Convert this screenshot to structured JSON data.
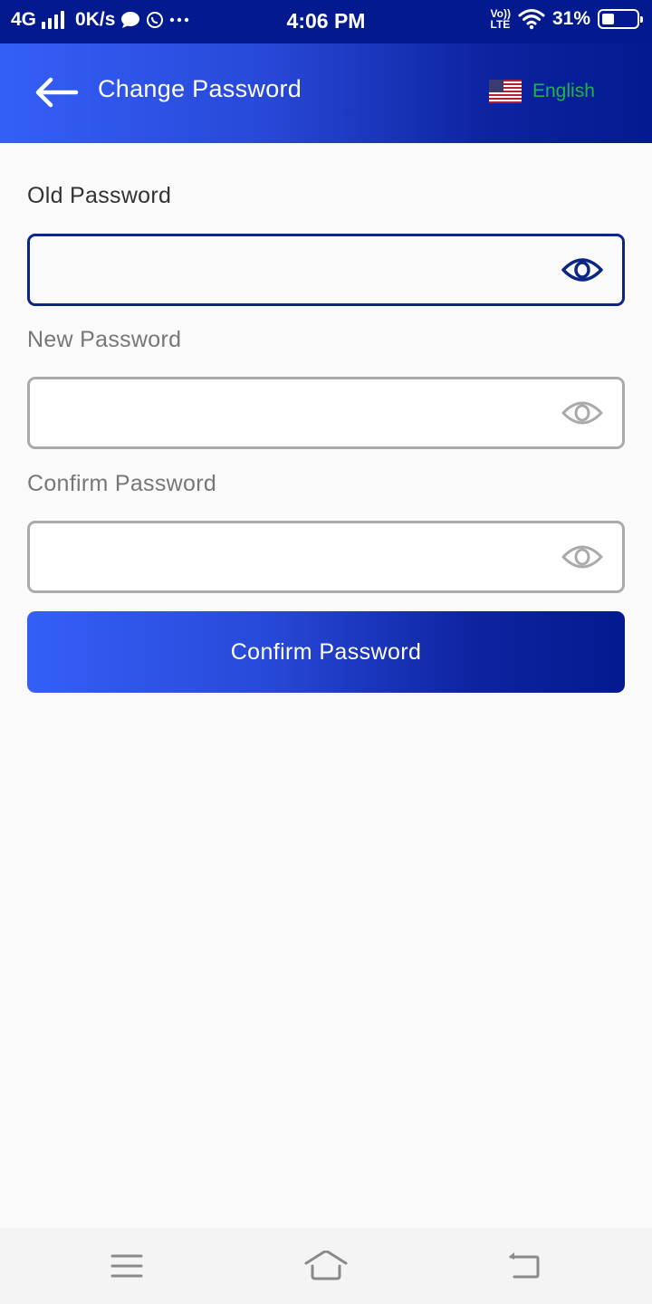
{
  "status_bar": {
    "network": "4G",
    "speed": "0K/s",
    "time": "4:06 PM",
    "volte_top": "Vo))",
    "volte_bottom": "LTE",
    "battery": "31%",
    "battery_level": 0.31,
    "icons": [
      "signal-icon",
      "message-icon",
      "whatsapp-icon",
      "more-icon",
      "volte-icon",
      "wifi-icon",
      "battery-icon"
    ]
  },
  "header": {
    "title": "Change Password",
    "back_icon": "arrow-left-icon",
    "language": {
      "label": "English",
      "flag_icon": "us-flag-icon",
      "color": "#1fb34a"
    }
  },
  "form": {
    "fields": [
      {
        "label": "Old Password",
        "value": "",
        "placeholder": "",
        "state": "focused",
        "toggle_icon": "eye-icon"
      },
      {
        "label": "New Password",
        "value": "",
        "placeholder": "",
        "state": "idle",
        "toggle_icon": "eye-icon"
      },
      {
        "label": "Confirm Password",
        "value": "",
        "placeholder": "",
        "state": "idle",
        "toggle_icon": "eye-icon"
      }
    ],
    "submit_label": "Confirm Password"
  },
  "colors": {
    "primary_start": "#345ff7",
    "primary_end": "#031a8f",
    "focused_border": "#0b2684",
    "idle_border": "#aaaaaa",
    "language_text": "#1fb34a"
  },
  "nav_bar": {
    "buttons": [
      "menu-icon",
      "home-icon",
      "back-icon"
    ]
  }
}
